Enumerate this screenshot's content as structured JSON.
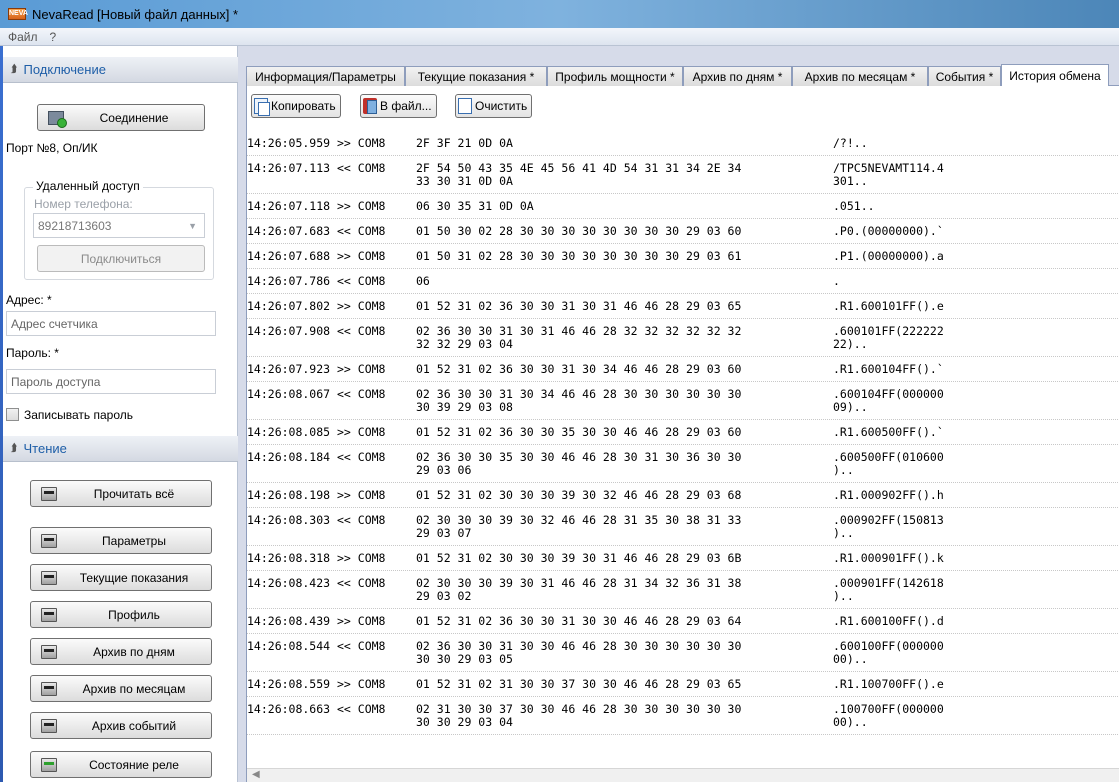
{
  "window": {
    "title": "NevaRead [Новый файл данных] *",
    "app_icon_text": "NEVA"
  },
  "menu": {
    "items": [
      "Файл",
      "?"
    ]
  },
  "left_panel": {
    "connection_header": "Подключение",
    "connect_button": "Соединение",
    "port_info": "Порт №8, Оп/ИК",
    "remote_access": {
      "title": "Удаленный доступ",
      "phone_label": "Номер телефона:",
      "phone_value": "89218713603",
      "connect_button": "Подключиться"
    },
    "address_label": "Адрес: *",
    "address_placeholder": "Адрес счетчика",
    "password_label": "Пароль: *",
    "password_placeholder": "Пароль доступа",
    "save_password_label": "Записывать пароль",
    "reading_header": "Чтение",
    "read_buttons": [
      "Прочитать всё",
      "Параметры",
      "Текущие показания",
      "Профиль",
      "Архив по дням",
      "Архив по месяцам",
      "Архив событий",
      "Состояние реле"
    ]
  },
  "tabs": [
    "Информация/Параметры",
    "Текущие показания *",
    "Профиль мощности *",
    "Архив по дням *",
    "Архив по месяцам *",
    "События *",
    "История обмена"
  ],
  "toolbar": {
    "copy": "Копировать",
    "to_file": "В файл...",
    "clear": "Очистить"
  },
  "log": [
    {
      "head": "14:26:05.959 >> COM8",
      "hex": "2F 3F 21 0D 0A",
      "ascii": "/?!.."
    },
    {
      "head": "14:26:07.113 << COM8",
      "hex": "2F 54 50 43 35 4E 45 56 41 4D 54 31 31 34 2E 34\n33 30 31 0D 0A",
      "ascii": "/TPC5NEVAMT114.4\n301.."
    },
    {
      "head": "14:26:07.118 >> COM8",
      "hex": "06 30 35 31 0D 0A",
      "ascii": ".051.."
    },
    {
      "head": "14:26:07.683 << COM8",
      "hex": "01 50 30 02 28 30 30 30 30 30 30 30 30 29 03 60",
      "ascii": ".P0.(00000000).`"
    },
    {
      "head": "14:26:07.688 >> COM8",
      "hex": "01 50 31 02 28 30 30 30 30 30 30 30 30 29 03 61",
      "ascii": ".P1.(00000000).a"
    },
    {
      "head": "14:26:07.786 << COM8",
      "hex": "06",
      "ascii": "."
    },
    {
      "head": "14:26:07.802 >> COM8",
      "hex": "01 52 31 02 36 30 30 31 30 31 46 46 28 29 03 65",
      "ascii": ".R1.600101FF().e"
    },
    {
      "head": "14:26:07.908 << COM8",
      "hex": "02 36 30 30 31 30 31 46 46 28 32 32 32 32 32 32\n32 32 29 03 04",
      "ascii": ".600101FF(222222\n22).."
    },
    {
      "head": "14:26:07.923 >> COM8",
      "hex": "01 52 31 02 36 30 30 31 30 34 46 46 28 29 03 60",
      "ascii": ".R1.600104FF().`"
    },
    {
      "head": "14:26:08.067 << COM8",
      "hex": "02 36 30 30 31 30 34 46 46 28 30 30 30 30 30 30\n30 39 29 03 08",
      "ascii": ".600104FF(000000\n09).."
    },
    {
      "head": "14:26:08.085 >> COM8",
      "hex": "01 52 31 02 36 30 30 35 30 30 46 46 28 29 03 60",
      "ascii": ".R1.600500FF().`"
    },
    {
      "head": "14:26:08.184 << COM8",
      "hex": "02 36 30 30 35 30 30 46 46 28 30 31 30 36 30 30\n29 03 06",
      "ascii": ".600500FF(010600\n).."
    },
    {
      "head": "14:26:08.198 >> COM8",
      "hex": "01 52 31 02 30 30 30 39 30 32 46 46 28 29 03 68",
      "ascii": ".R1.000902FF().h"
    },
    {
      "head": "14:26:08.303 << COM8",
      "hex": "02 30 30 30 39 30 32 46 46 28 31 35 30 38 31 33\n29 03 07",
      "ascii": ".000902FF(150813\n).."
    },
    {
      "head": "14:26:08.318 >> COM8",
      "hex": "01 52 31 02 30 30 30 39 30 31 46 46 28 29 03 6B",
      "ascii": ".R1.000901FF().k"
    },
    {
      "head": "14:26:08.423 << COM8",
      "hex": "02 30 30 30 39 30 31 46 46 28 31 34 32 36 31 38\n29 03 02",
      "ascii": ".000901FF(142618\n).."
    },
    {
      "head": "14:26:08.439 >> COM8",
      "hex": "01 52 31 02 36 30 30 31 30 30 46 46 28 29 03 64",
      "ascii": ".R1.600100FF().d"
    },
    {
      "head": "14:26:08.544 << COM8",
      "hex": "02 36 30 30 31 30 30 46 46 28 30 30 30 30 30 30\n30 30 29 03 05",
      "ascii": ".600100FF(000000\n00).."
    },
    {
      "head": "14:26:08.559 >> COM8",
      "hex": "01 52 31 02 31 30 30 37 30 30 46 46 28 29 03 65",
      "ascii": ".R1.100700FF().e"
    },
    {
      "head": "14:26:08.663 << COM8",
      "hex": "02 31 30 30 37 30 30 46 46 28 30 30 30 30 30 30\n30 30 29 03 04",
      "ascii": ".100700FF(000000\n00).."
    }
  ],
  "colors": {
    "accent": "#1f5fa8",
    "titlebar": "#5a9bd5",
    "sidebar_edge": "#3a6fd0"
  },
  "icons": {
    "connect": "plug-connected-icon",
    "read": "meter-device-icon",
    "copy": "copy-icon",
    "file": "save-file-icon",
    "clear": "clear-page-icon"
  }
}
